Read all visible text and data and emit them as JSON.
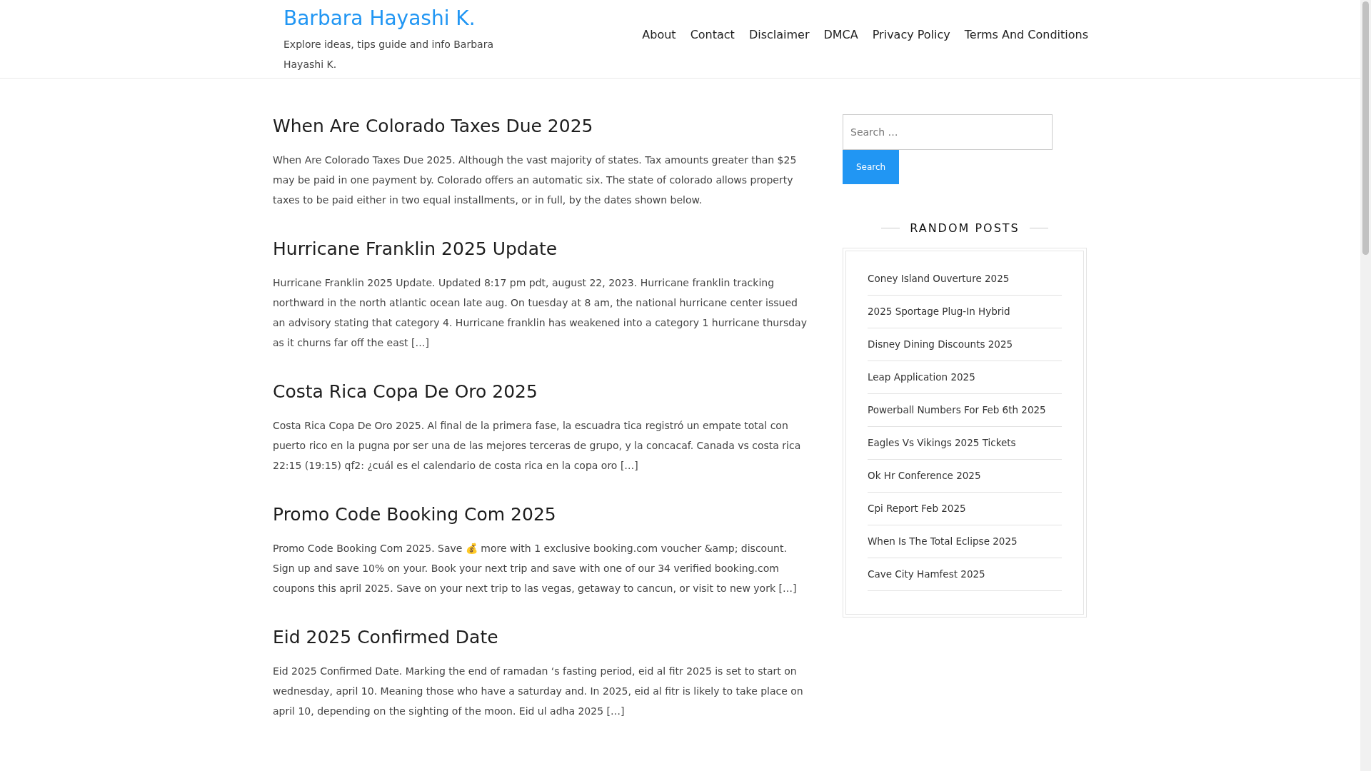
{
  "site": {
    "title": "Barbara Hayashi K.",
    "tagline": "Explore ideas, tips guide and info Barbara Hayashi K."
  },
  "nav": [
    {
      "label": "About"
    },
    {
      "label": "Contact"
    },
    {
      "label": "Disclaimer"
    },
    {
      "label": "DMCA"
    },
    {
      "label": "Privacy Policy"
    },
    {
      "label": "Terms And Conditions"
    }
  ],
  "posts": [
    {
      "title": "When Are Colorado Taxes Due 2025",
      "excerpt": "When Are Colorado Taxes Due 2025. Although the vast majority of states. Tax amounts greater than $25 may be paid in one payment by. Colorado offers an automatic six. The state of colorado allows property taxes to be paid either in two equal installments, or in full, by the dates shown below."
    },
    {
      "title": "Hurricane Franklin 2025 Update",
      "excerpt": "Hurricane Franklin 2025 Update. Updated 8:17 pm pdt, august 22, 2023. Hurricane franklin tracking northward in the north atlantic ocean late aug. On tuesday at 8 am, the national hurricane center issued an advisory stating that category 4. Hurricane franklin has weakened into a category 1 hurricane thursday as it churns far off the east […]"
    },
    {
      "title": "Costa Rica Copa De Oro 2025",
      "excerpt": "Costa Rica Copa De Oro 2025. Al final de la primera fase, la escuadra tica registró un empate total con puerto rico en la pugna por ser una de las mejores terceras de grupo, y la concacaf. Canada vs costa rica 22:15 (19:15) qf2: ¿cuál es el calendario de costa rica en la copa oro […]"
    },
    {
      "title": "Promo Code Booking Com 2025",
      "excerpt": "Promo Code Booking Com 2025. Save 💰 more with 1 exclusive booking.com voucher &amp; discount. Sign up and save 10% on your. Book your next trip and save with one of our 34 verified booking.com coupons this april 2025. Save on your next trip to las vegas, getaway to cancun, or visit to new york […]"
    },
    {
      "title": "Eid 2025 Confirmed Date",
      "excerpt": "Eid 2025 Confirmed Date. Marking the end of ramadan ‘s fasting period, eid al fitr 2025 is set to start on wednesday, april 10. Meaning those who have a saturday and. In 2025, eid al fitr is likely to take place on april 10, depending on the sighting of the moon. Eid ul adha 2025 […]"
    }
  ],
  "search": {
    "placeholder": "Search …",
    "button": "Search"
  },
  "random_posts": {
    "title": "RANDOM POSTS",
    "items": [
      "Coney Island Ouverture 2025",
      "2025 Sportage Plug-In Hybrid",
      "Disney Dining Discounts 2025",
      "Leap Application 2025",
      "Powerball Numbers For Feb 6th 2025",
      "Eagles Vs Vikings 2025 Tickets",
      "Ok Hr Conference 2025",
      "Cpi Report Feb 2025",
      "When Is The Total Eclipse 2025",
      "Cave City Hamfest 2025"
    ]
  }
}
